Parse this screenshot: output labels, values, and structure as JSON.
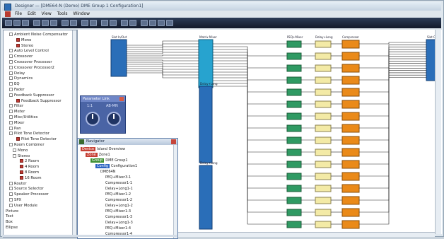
{
  "window": {
    "title": "Designer — [DME64-N (Demo) DME Group 1 Configuration1]"
  },
  "menu": {
    "items": [
      "File",
      "Edit",
      "View",
      "Tools",
      "Window"
    ]
  },
  "tree": {
    "items": [
      {
        "label": "Ambient Noise Compensator",
        "indent": 1,
        "icon": "exp"
      },
      {
        "label": "Mono",
        "indent": 3,
        "icon": "red"
      },
      {
        "label": "Stereo",
        "indent": 3,
        "icon": "red"
      },
      {
        "label": "Auto Level Control",
        "indent": 1,
        "icon": "exp"
      },
      {
        "label": "Crossover",
        "indent": 1,
        "icon": "exp"
      },
      {
        "label": "Crossover Processor",
        "indent": 1,
        "icon": "exp"
      },
      {
        "label": "Crossover Processor2",
        "indent": 1,
        "icon": "exp"
      },
      {
        "label": "Delay",
        "indent": 1,
        "icon": "exp"
      },
      {
        "label": "Dynamics",
        "indent": 1,
        "icon": "exp"
      },
      {
        "label": "EQ",
        "indent": 1,
        "icon": "exp"
      },
      {
        "label": "Fader",
        "indent": 1,
        "icon": "exp"
      },
      {
        "label": "Feedback Suppressor",
        "indent": 1,
        "icon": "exp"
      },
      {
        "label": "Feedback Suppressor",
        "indent": 3,
        "icon": "red"
      },
      {
        "label": "Filter",
        "indent": 1,
        "icon": "exp"
      },
      {
        "label": "Meter",
        "indent": 1,
        "icon": "exp"
      },
      {
        "label": "Misc/Utilities",
        "indent": 1,
        "icon": "exp"
      },
      {
        "label": "Mixer",
        "indent": 1,
        "icon": "exp"
      },
      {
        "label": "Pan",
        "indent": 1,
        "icon": "exp"
      },
      {
        "label": "Pilot Tone Detector",
        "indent": 1,
        "icon": "exp"
      },
      {
        "label": "Pilot Tone Detector",
        "indent": 3,
        "icon": "red"
      },
      {
        "label": "Room Combiner",
        "indent": 1,
        "icon": "exp"
      },
      {
        "label": "Mono",
        "indent": 2,
        "icon": "exp"
      },
      {
        "label": "Stereo",
        "indent": 2,
        "icon": "exp"
      },
      {
        "label": "2 Room",
        "indent": 4,
        "icon": "red"
      },
      {
        "label": "4 Room",
        "indent": 4,
        "icon": "red"
      },
      {
        "label": "8 Room",
        "indent": 4,
        "icon": "red"
      },
      {
        "label": "16 Room",
        "indent": 4,
        "icon": "red"
      },
      {
        "label": "Router",
        "indent": 1,
        "icon": "exp"
      },
      {
        "label": "Source Selector",
        "indent": 1,
        "icon": "exp"
      },
      {
        "label": "Speaker Processor",
        "indent": 1,
        "icon": "exp"
      },
      {
        "label": "SPX",
        "indent": 1,
        "icon": "exp"
      },
      {
        "label": "User Module",
        "indent": 1,
        "icon": "exp"
      },
      {
        "label": "Picture",
        "indent": 0,
        "icon": "none"
      },
      {
        "label": "Text",
        "indent": 0,
        "icon": "none"
      },
      {
        "label": "Box",
        "indent": 0,
        "icon": "none"
      },
      {
        "label": "Ellipse",
        "indent": 0,
        "icon": "none"
      }
    ]
  },
  "meter": {
    "title": "Parameter Link",
    "left_label": "1:1",
    "right_label": "AB-MN"
  },
  "navigator": {
    "title": "Navigator",
    "items": [
      {
        "label": "Island Overview",
        "tag": "Device",
        "tag_color": "red",
        "indent": 0
      },
      {
        "label": "Zone1",
        "tag": "Zone",
        "tag_color": "red",
        "indent": 1
      },
      {
        "label": "DME Group1",
        "tag": "Group",
        "tag_color": "grn",
        "indent": 2
      },
      {
        "label": "Configuration1",
        "tag": "Config",
        "tag_color": "blu",
        "indent": 3
      },
      {
        "label": "DME64N",
        "tag": "",
        "tag_color": "",
        "indent": 4
      },
      {
        "label": "PEQ+Mixer3-1",
        "tag": "",
        "tag_color": "",
        "indent": 5
      },
      {
        "label": "Compressor1-1",
        "tag": "",
        "tag_color": "",
        "indent": 5
      },
      {
        "label": "Delay+Long1-1",
        "tag": "",
        "tag_color": "",
        "indent": 5
      },
      {
        "label": "PEQ+Mixer1-2",
        "tag": "",
        "tag_color": "",
        "indent": 5
      },
      {
        "label": "Compressor1-2",
        "tag": "",
        "tag_color": "",
        "indent": 5
      },
      {
        "label": "Delay+Long1-2",
        "tag": "",
        "tag_color": "",
        "indent": 5
      },
      {
        "label": "PEQ+Mixer1-3",
        "tag": "",
        "tag_color": "",
        "indent": 5
      },
      {
        "label": "Compressor1-3",
        "tag": "",
        "tag_color": "",
        "indent": 5
      },
      {
        "label": "Delay+Long1-3",
        "tag": "",
        "tag_color": "",
        "indent": 5
      },
      {
        "label": "PEQ+Mixer1-4",
        "tag": "",
        "tag_color": "",
        "indent": 5
      },
      {
        "label": "Compressor1-4",
        "tag": "",
        "tag_color": "",
        "indent": 5
      }
    ]
  },
  "canvas": {
    "slot_in_label": "Slot In/Out",
    "matrix_label": "Matrix Mixer",
    "peq_label": "PEQ+Mixer",
    "delay_label": "Delay+Long",
    "comp_label": "Compressor",
    "out_label": "Slot Out",
    "mid_label_1": "Delay+Long",
    "mid_label_2": "Delay+Long",
    "colors": {
      "blue_block": "#2a6eb8",
      "cyan_block": "#27a3cf",
      "green_block": "#2f9a63",
      "cream_block": "#f3eaa6",
      "orange_block": "#ea8a19",
      "wire": "#222222"
    }
  }
}
